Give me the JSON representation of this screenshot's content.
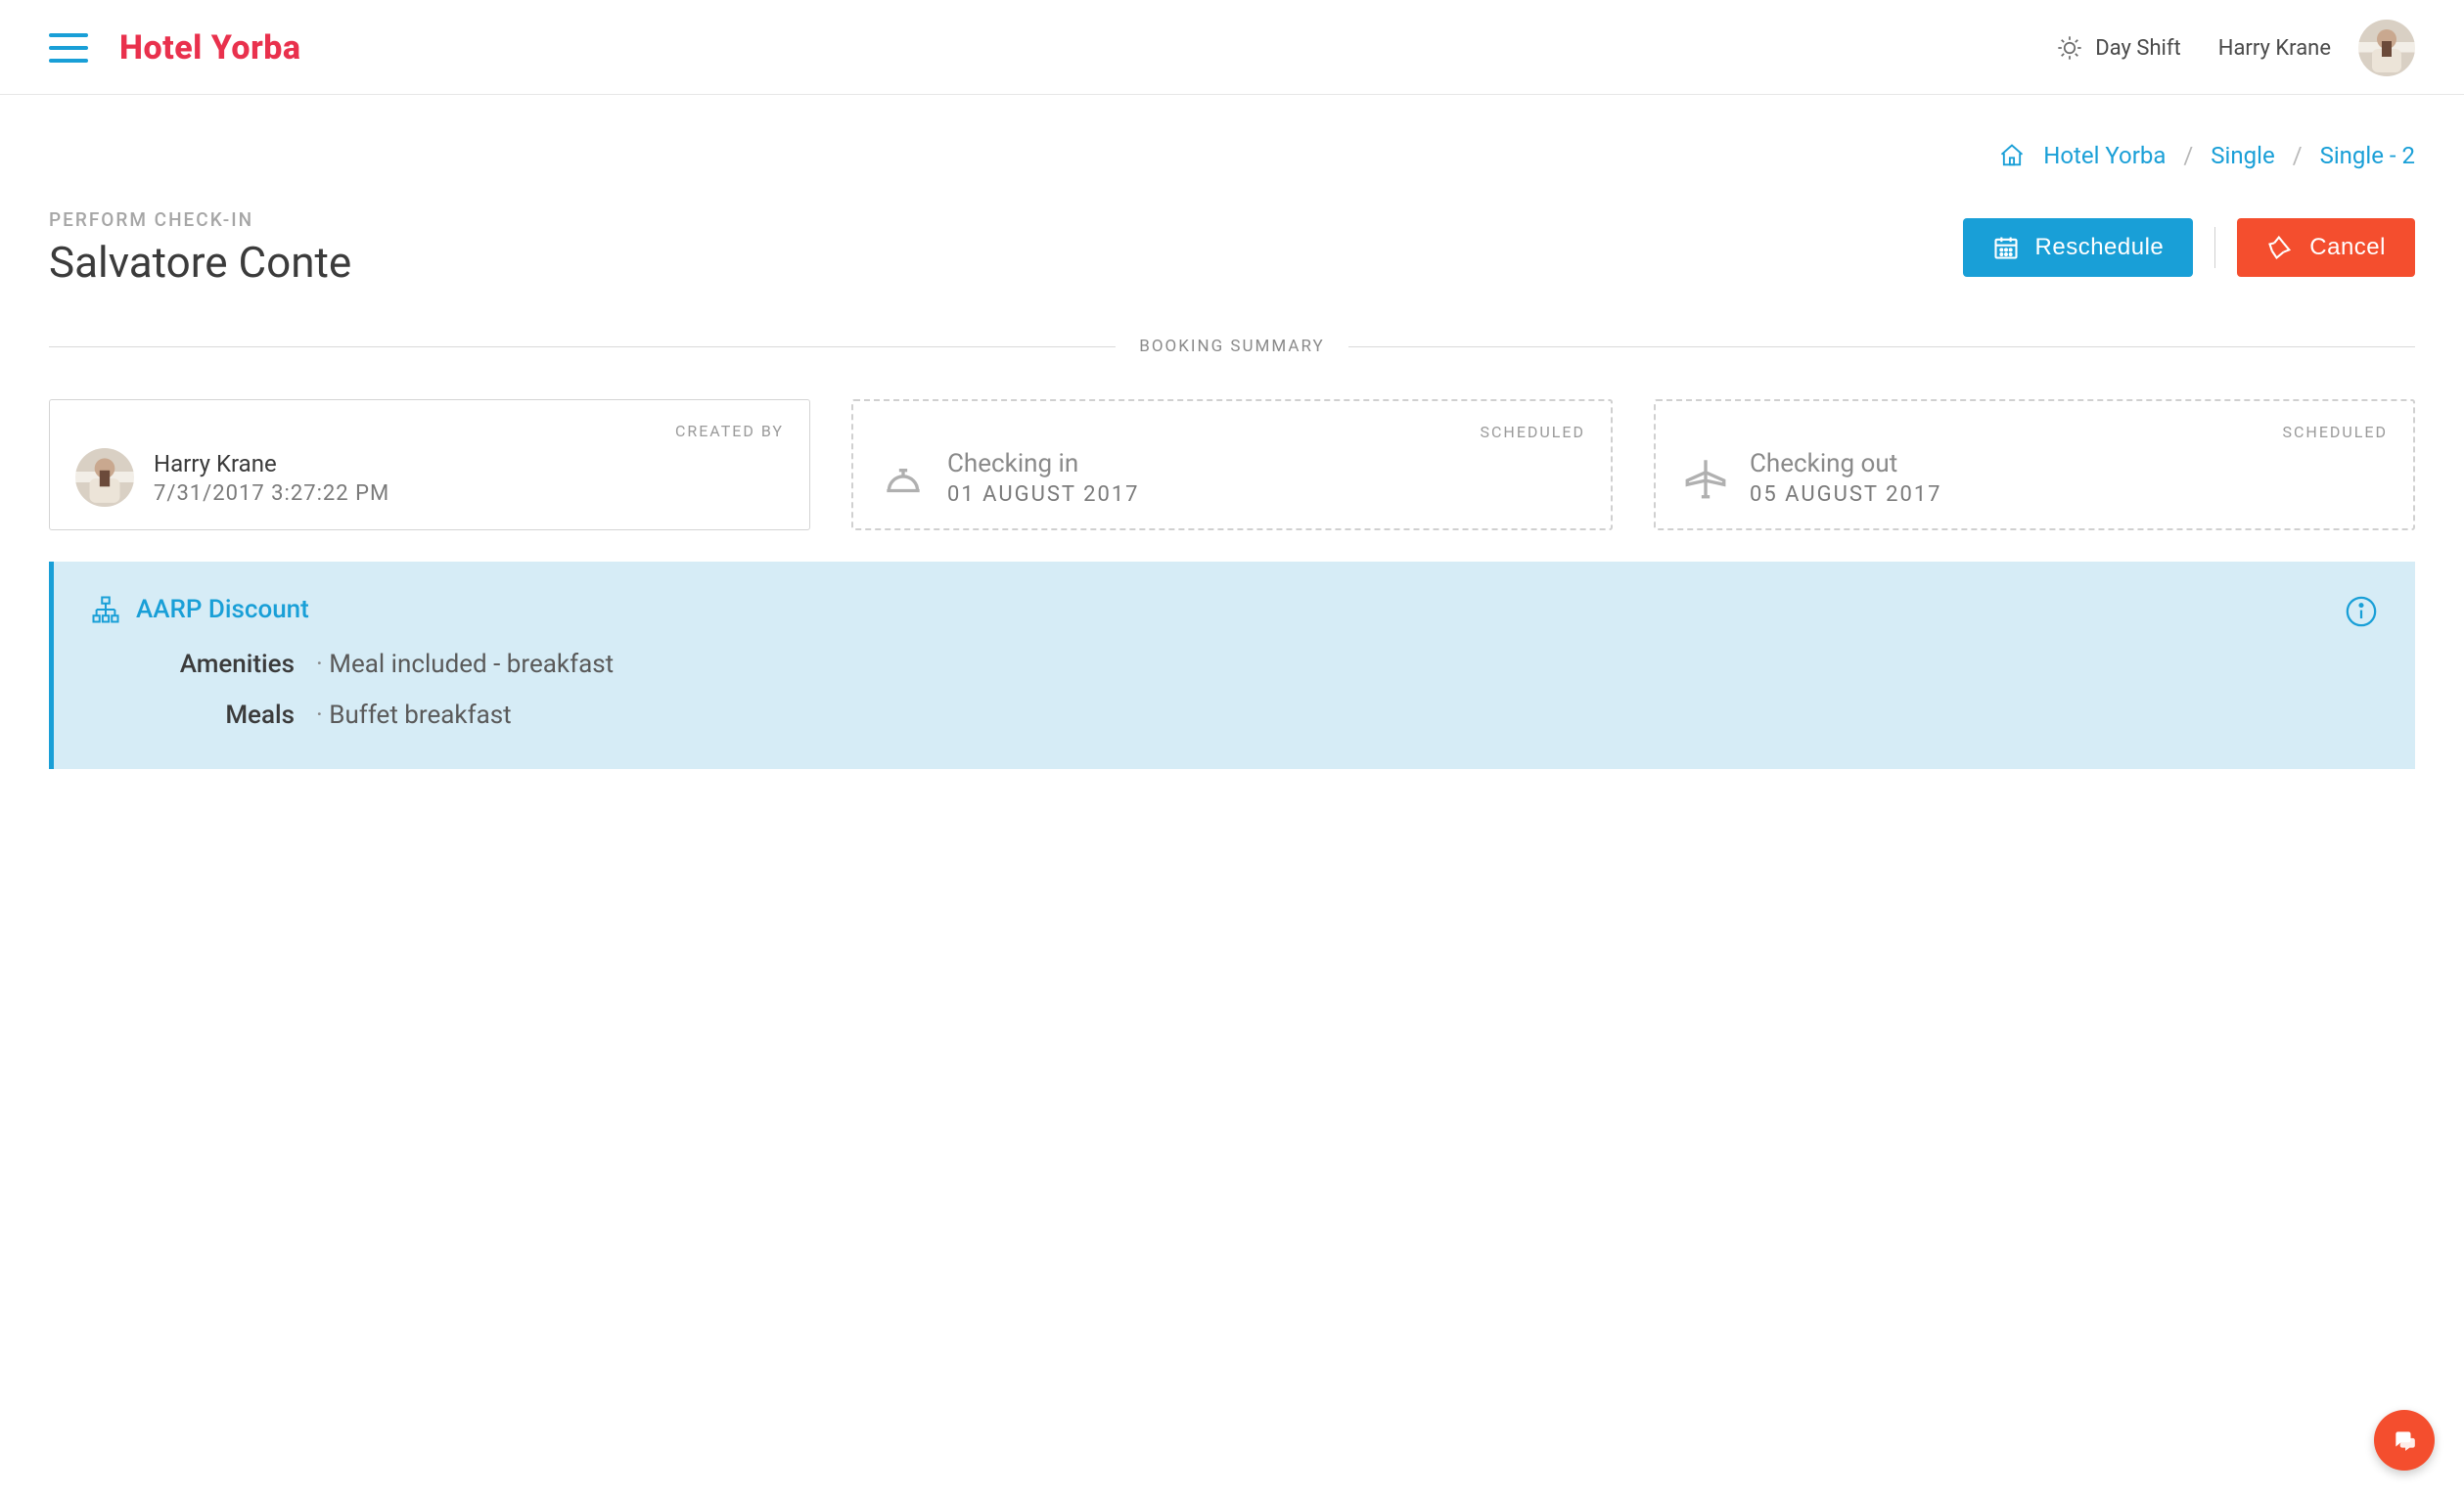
{
  "header": {
    "brand": "Hotel Yorba",
    "shift_label": "Day Shift",
    "username": "Harry Krane"
  },
  "breadcrumb": {
    "items": [
      "Hotel Yorba",
      "Single",
      "Single - 2"
    ]
  },
  "page": {
    "kicker": "PERFORM CHECK-IN",
    "title": "Salvatore Conte",
    "reschedule_label": "Reschedule",
    "cancel_label": "Cancel"
  },
  "section": {
    "booking_summary_label": "BOOKING SUMMARY"
  },
  "summary": {
    "created_by": {
      "label": "CREATED BY",
      "name": "Harry Krane",
      "datetime": "7/31/2017 3:27:22 PM"
    },
    "check_in": {
      "label": "SCHEDULED",
      "title": "Checking in",
      "date": "01 AUGUST 2017"
    },
    "check_out": {
      "label": "SCHEDULED",
      "title": "Checking out",
      "date": "05 AUGUST 2017"
    }
  },
  "discount": {
    "title": "AARP Discount",
    "amenities_label": "Amenities",
    "amenities_value": "Meal included - breakfast",
    "meals_label": "Meals",
    "meals_value": "Buffet breakfast"
  }
}
